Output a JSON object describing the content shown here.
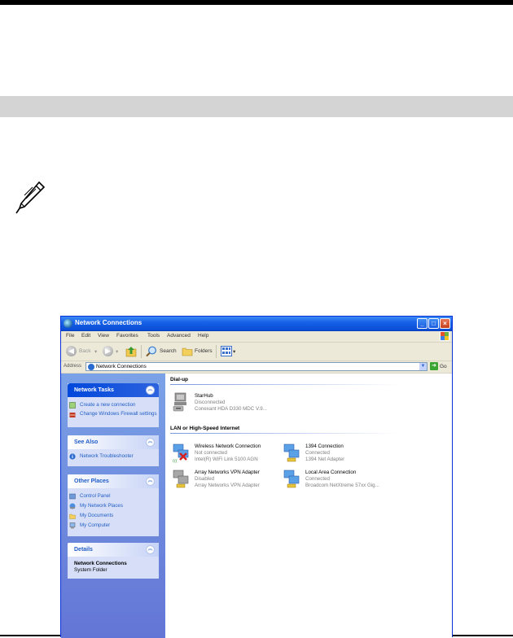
{
  "window": {
    "title": "Network Connections",
    "controls": {
      "minimize": "_",
      "maximize": "□",
      "close": "×"
    }
  },
  "menu": [
    "File",
    "Edit",
    "View",
    "Favorites",
    "Tools",
    "Advanced",
    "Help"
  ],
  "toolbar": {
    "back": "Back",
    "search": "Search",
    "folders": "Folders"
  },
  "address": {
    "label": "Address",
    "value": "Network Connections",
    "go": "Go"
  },
  "tasks": {
    "network_tasks": {
      "title": "Network Tasks",
      "items": [
        "Create a new connection",
        "Change Windows Firewall settings"
      ]
    },
    "see_also": {
      "title": "See Also",
      "items": [
        "Network Troubleshooter"
      ]
    },
    "other_places": {
      "title": "Other Places",
      "items": [
        "Control Panel",
        "My Network Places",
        "My Documents",
        "My Computer"
      ]
    },
    "details": {
      "title": "Details",
      "name": "Network Connections",
      "type": "System Folder"
    }
  },
  "groups": {
    "dialup": {
      "title": "Dial-up",
      "items": [
        {
          "name": "StarHub",
          "status": "Disconnected",
          "device": "Conexant HDA D330 MDC V.9..."
        }
      ]
    },
    "lan": {
      "title": "LAN or High-Speed Internet",
      "items": [
        {
          "name": "Wireless Network Connection",
          "status": "Not connected",
          "device": "Intel(R) WiFi Link 5100 AGN"
        },
        {
          "name": "1394 Connection",
          "status": "Connected",
          "device": "1394 Net Adapter"
        },
        {
          "name": "Array Networks VPN Adapter",
          "status": "Disabled",
          "device": "Array Networks VPN Adapter"
        },
        {
          "name": "Local Area Connection",
          "status": "Connected",
          "device": "Broadcom NetXtreme 57xx Gig..."
        }
      ]
    }
  },
  "colors": {
    "title_blue": "#0a4ed6",
    "task_blue": "#215dc6",
    "pane_blue": "#6375d6",
    "gray_band": "#d4d4d4"
  }
}
